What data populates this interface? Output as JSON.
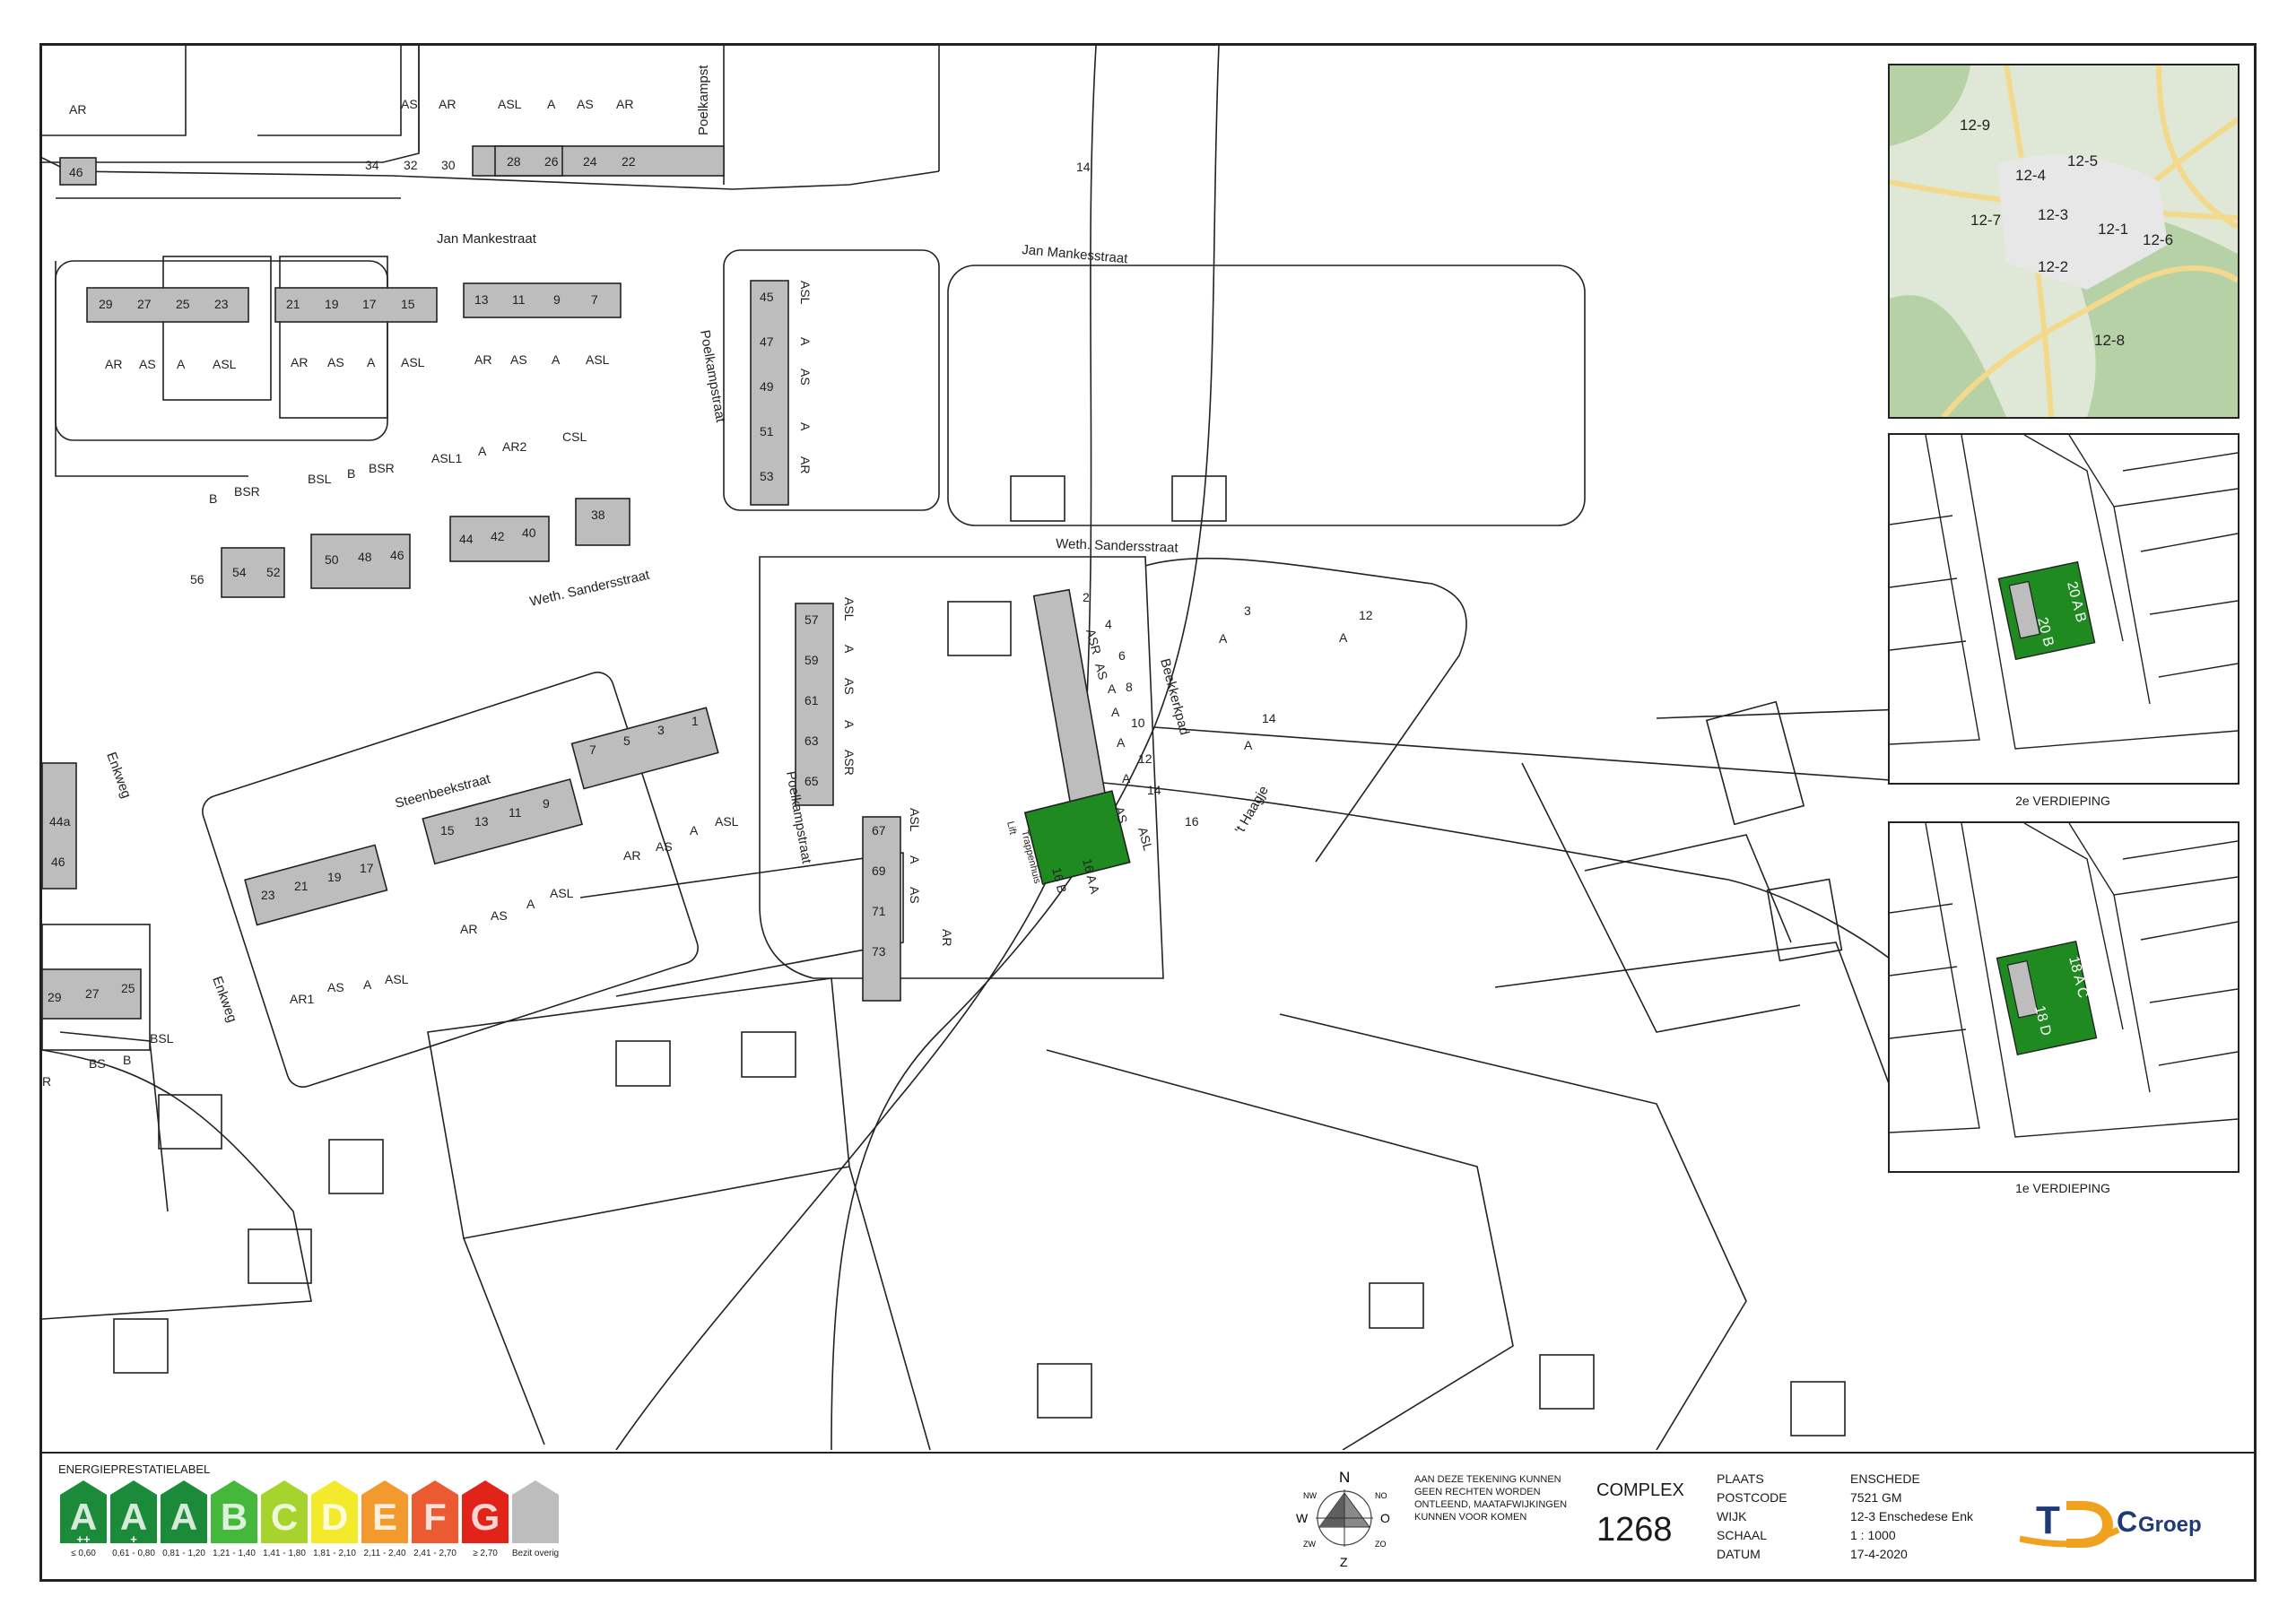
{
  "map": {
    "streets": {
      "jan_mankestraat_1": "Jan Mankestraat",
      "jan_mankesstraat_2": "Jan Mankesstraat",
      "poelkampstraat_top": "Poelkampst",
      "poelkampstraat_mid": "Poelkampstraat",
      "poelkampstraat_low": "Poelkampstraat",
      "weth_sandersstraat_1": "Weth. Sandersstraat",
      "weth_sandersstraat_2": "Weth. Sandersstraat",
      "steenbeekstraat": "Steenbeekstraat",
      "beekkerkpad": "Beekkerkpad",
      "t_haagje": "'t Haagje",
      "enkweg_1": "Enkweg",
      "enkweg_2": "Enkweg"
    },
    "house_numbers": {
      "n46_top": "46",
      "n34": "34",
      "n32": "32",
      "n30": "30",
      "n28": "28",
      "n26": "26",
      "n24": "24",
      "n22": "22",
      "n14_top": "14",
      "n29a": "29",
      "n27a": "27",
      "n25a": "25",
      "n23a": "23",
      "n21a": "21",
      "n19a": "19",
      "n17a": "17",
      "n15a": "15",
      "n13a": "13",
      "n11a": "11",
      "n9a": "9",
      "n7a": "7",
      "n45": "45",
      "n47": "47",
      "n49": "49",
      "n51": "51",
      "n53": "53",
      "n56": "56",
      "n54": "54",
      "n52": "52",
      "n50": "50",
      "n48": "48",
      "n46b": "46",
      "n44": "44",
      "n42": "42",
      "n40": "40",
      "n38": "38",
      "n57": "57",
      "n59": "59",
      "n61": "61",
      "n63": "63",
      "n65": "65",
      "n67": "67",
      "n69": "69",
      "n71": "71",
      "n73": "73",
      "n2": "2",
      "n4": "4",
      "n6": "6",
      "n8": "8",
      "n10": "10",
      "n12b": "12",
      "n14b": "14",
      "n16": "16",
      "n3c": "3",
      "n12c": "12",
      "n14c": "14",
      "n7b": "7",
      "n5b": "5",
      "n3b": "3",
      "n1b": "1",
      "n15b": "15",
      "n13b": "13",
      "n11b": "11",
      "n9b": "9",
      "n23b": "23",
      "n21b": "21",
      "n19b": "19",
      "n17b": "17",
      "n44a": "44a",
      "n46c": "46",
      "n29b": "29",
      "n27b": "27",
      "n25b": "25",
      "n16b": "16 B",
      "n16a": "16 A A"
    },
    "codes": {
      "c_ar_1": "AR",
      "c_as_1": "AS",
      "c_ar_2": "AR",
      "c_asl_1": "ASL",
      "c_a_1": "A",
      "c_as_2": "AS",
      "c_ar_3": "AR",
      "c_ar_4": "AR",
      "c_as_3": "AS",
      "c_a_2": "A",
      "c_asl_2": "ASL",
      "c_ar_5": "AR",
      "c_as_4": "AS",
      "c_a_3": "A",
      "c_asl_3": "ASL",
      "c_ar_6": "AR",
      "c_as_5": "AS",
      "c_a_4": "A",
      "c_asl_4": "ASL",
      "c_asl_5": "ASL",
      "c_a_5": "A",
      "c_as_6": "AS",
      "c_a_6": "A",
      "c_ar_7": "AR",
      "c_b_1": "B",
      "c_bsr_1": "BSR",
      "c_bsl_1": "BSL",
      "c_b_2": "B",
      "c_bsr_2": "BSR",
      "c_asl1": "ASL1",
      "c_a_7": "A",
      "c_ar2": "AR2",
      "c_csl": "CSL",
      "c_asl_6": "ASL",
      "c_a_8": "A",
      "c_as_7": "AS",
      "c_a_9": "A",
      "c_asr_1": "ASR",
      "c_asl_7": "ASL",
      "c_a_10": "A",
      "c_as_8": "AS",
      "c_ar_8": "AR",
      "c_asr_2": "ASR",
      "c_as_9": "AS",
      "c_a_11": "A",
      "c_a_12": "A",
      "c_a_13": "A",
      "c_a_14": "A",
      "c_as_10": "AS",
      "c_asl_8": "ASL",
      "c_a_3c": "A",
      "c_a_12c": "A",
      "c_a_14c": "A",
      "c_ar_9": "AR",
      "c_as_11": "AS",
      "c_a_15": "A",
      "c_asl_9": "ASL",
      "c_ar_10": "AR",
      "c_as_12": "AS",
      "c_a_16": "A",
      "c_asl_10": "ASL",
      "c_ar1": "AR1",
      "c_as_13": "AS",
      "c_a_17": "A",
      "c_asl_11": "ASL",
      "c_bs": "BS",
      "c_b_3": "B",
      "c_bsl_2": "BSL",
      "c_r": "R",
      "c_lift": "Lift",
      "c_trappenhuis": "Trappenhuis"
    }
  },
  "location_inset": {
    "districts": [
      "12-9",
      "12-5",
      "12-4",
      "12-3",
      "12-7",
      "12-1",
      "12-6",
      "12-2",
      "12-8"
    ],
    "colors": {
      "land": "#dfe8d6",
      "forest": "#b7d1a7",
      "roads": "#f3d98b"
    }
  },
  "floor_insets": [
    {
      "caption": "2e VERDIEPING",
      "unit_top": "20 A B",
      "unit_bottom": "20 B"
    },
    {
      "caption": "1e VERDIEPING",
      "unit_top": "18 A C",
      "unit_bottom": "18 D"
    }
  ],
  "legend": {
    "title": "ENERGIEPRESTATIELABEL",
    "labels": [
      {
        "letter": "A",
        "plus": "++",
        "range": "≤ 0,60",
        "color": "#1b8b3a"
      },
      {
        "letter": "A",
        "plus": "+",
        "range": "0,61 - 0,80",
        "color": "#1b8b3a"
      },
      {
        "letter": "A",
        "plus": "",
        "range": "0,81 - 1,20",
        "color": "#1b8b3a"
      },
      {
        "letter": "B",
        "plus": "",
        "range": "1,21 - 1,40",
        "color": "#45b83c"
      },
      {
        "letter": "C",
        "plus": "",
        "range": "1,41 - 1,80",
        "color": "#a6d32c"
      },
      {
        "letter": "D",
        "plus": "",
        "range": "1,81 - 2,10",
        "color": "#f3ea2c"
      },
      {
        "letter": "E",
        "plus": "",
        "range": "2,11 - 2,40",
        "color": "#f29a2e"
      },
      {
        "letter": "F",
        "plus": "",
        "range": "2,41 - 2,70",
        "color": "#ec5a32"
      },
      {
        "letter": "G",
        "plus": "",
        "range": "≥ 2,70",
        "color": "#e2231a"
      },
      {
        "letter": "",
        "plus": "",
        "range": "Bezit overig",
        "color": "#bdbdbd"
      }
    ]
  },
  "compass": {
    "n": "N",
    "o": "O",
    "z": "Z",
    "w": "W",
    "nw": "NW",
    "no": "NO",
    "zw": "ZW",
    "zo": "ZO"
  },
  "disclaimer": "AAN DEZE TEKENING KUNNEN GEEN RECHTEN WORDEN ONTLEEND, MAATAFWIJKINGEN KUNNEN VOOR KOMEN",
  "complex": {
    "label": "COMPLEX",
    "number": "1268"
  },
  "meta": [
    {
      "key": "PLAATS",
      "value": "ENSCHEDE"
    },
    {
      "key": "POSTCODE",
      "value": "7521 GM"
    },
    {
      "key": "WIJK",
      "value": "12-3 Enschedese Enk"
    },
    {
      "key": "SCHAAL",
      "value": "1 : 1000"
    },
    {
      "key": "DATUM",
      "value": "17-4-2020"
    }
  ],
  "logo": {
    "letters_t": "T",
    "letters_d": "D",
    "letters_c": "C",
    "word": "Groep",
    "color_blue": "#1e3a78",
    "color_orange": "#f0a21e"
  },
  "colors": {
    "owned": "#bdbdbd",
    "highlight": "#1f8a1f",
    "line": "#222222"
  }
}
